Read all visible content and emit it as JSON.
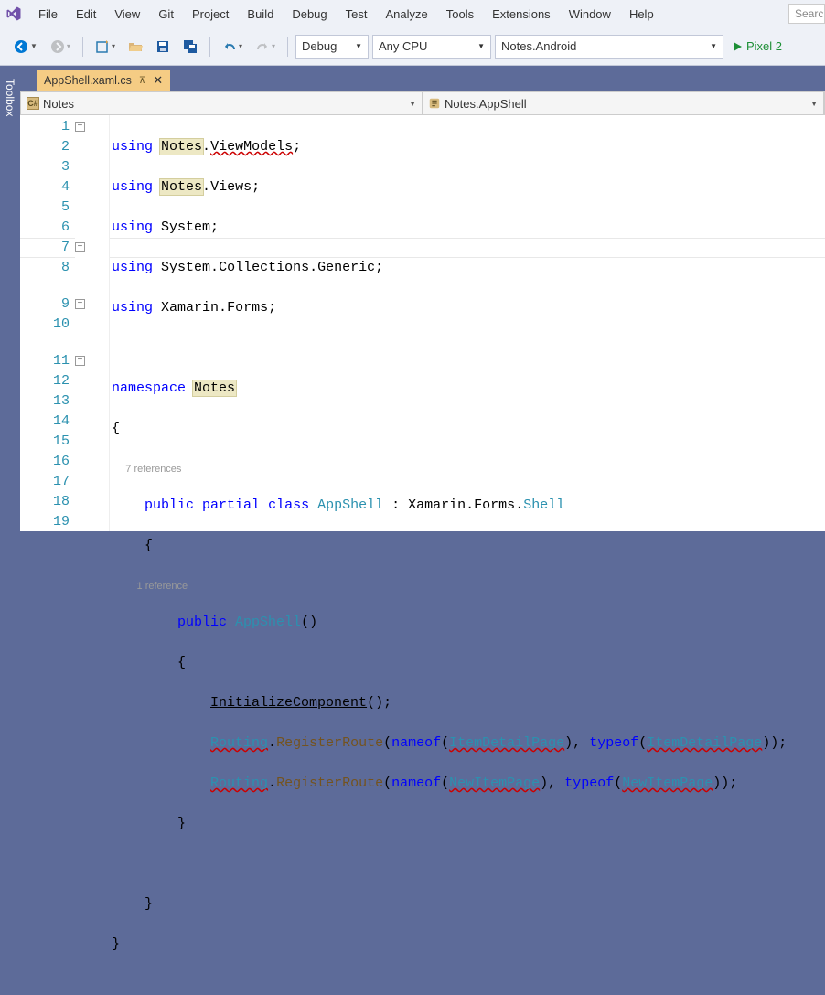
{
  "menu": {
    "items": [
      "File",
      "Edit",
      "View",
      "Git",
      "Project",
      "Build",
      "Debug",
      "Test",
      "Analyze",
      "Tools",
      "Extensions",
      "Window",
      "Help"
    ],
    "search_placeholder": "Search"
  },
  "toolbar": {
    "config": "Debug",
    "platform": "Any CPU",
    "startup": "Notes.Android",
    "run_target": "Pixel 2"
  },
  "side": {
    "toolbox": "Toolbox"
  },
  "tab": {
    "filename": "AppShell.xaml.cs"
  },
  "nav": {
    "left": "Notes",
    "right": "Notes.AppShell"
  },
  "code": {
    "lines": [
      "1",
      "2",
      "3",
      "4",
      "5",
      "6",
      "7",
      "8",
      "9",
      "10",
      "11",
      "12",
      "13",
      "14",
      "15",
      "16",
      "17",
      "18",
      "19"
    ],
    "codelens_class": "7 references",
    "codelens_ctor": "1 reference",
    "ns_notes": "Notes",
    "ns_viewmodels": "ViewModels",
    "ns_views": "Views",
    "ns_system": "System",
    "ns_collections": "Collections",
    "ns_generic": "Generic",
    "ns_xamarin": "Xamarin",
    "ns_forms": "Forms",
    "cls_appshell": "AppShell",
    "cls_shell": "Shell",
    "cls_routing": "Routing",
    "cls_itemdetail": "ItemDetailPage",
    "cls_newitem": "NewItemPage",
    "mth_init": "InitializeComponent",
    "mth_register": "RegisterRoute",
    "kw_using": "using",
    "kw_namespace": "namespace",
    "kw_public": "public",
    "kw_partial": "partial",
    "kw_class": "class",
    "kw_nameof": "nameof",
    "kw_typeof": "typeof"
  }
}
